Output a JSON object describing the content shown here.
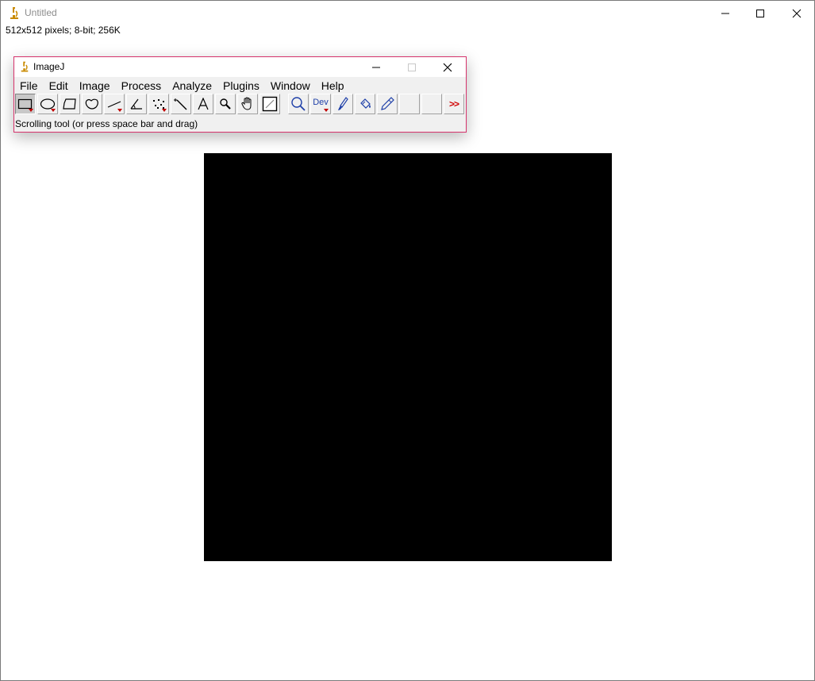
{
  "image_window": {
    "title": "Untitled",
    "info": "512x512 pixels; 8-bit; 256K",
    "icons": {
      "app": "microscope-icon",
      "minimize": "minimize-icon",
      "maximize": "maximize-icon",
      "close": "close-icon"
    }
  },
  "imagej_window": {
    "title": "ImageJ",
    "menu": [
      "File",
      "Edit",
      "Image",
      "Process",
      "Analyze",
      "Plugins",
      "Window",
      "Help"
    ],
    "tools": [
      {
        "name": "rectangle-tool",
        "icon": "rectangle-icon",
        "selected": true,
        "has_menu": true
      },
      {
        "name": "oval-tool",
        "icon": "oval-icon",
        "selected": false,
        "has_menu": true
      },
      {
        "name": "polygon-tool",
        "icon": "polygon-icon",
        "selected": false,
        "has_menu": false
      },
      {
        "name": "freehand-tool",
        "icon": "freehand-icon",
        "selected": false,
        "has_menu": false
      },
      {
        "name": "line-tool",
        "icon": "line-icon",
        "selected": false,
        "has_menu": true
      },
      {
        "name": "angle-tool",
        "icon": "angle-icon",
        "selected": false,
        "has_menu": false
      },
      {
        "name": "point-tool",
        "icon": "multipoint-icon",
        "selected": false,
        "has_menu": true
      },
      {
        "name": "wand-tool",
        "icon": "wand-icon",
        "selected": false,
        "has_menu": false
      },
      {
        "name": "text-tool",
        "icon": "text-icon",
        "selected": false,
        "has_menu": false
      },
      {
        "name": "magnifying-tool",
        "icon": "magnifier-icon",
        "selected": false,
        "has_menu": false
      },
      {
        "name": "scrolling-tool",
        "icon": "hand-icon",
        "selected": false,
        "has_menu": false
      },
      {
        "name": "color-picker-tool",
        "icon": "color-picker-icon",
        "selected": false,
        "has_menu": false
      },
      {
        "name": "zoom-tool",
        "icon": "zoom-icon",
        "selected": false,
        "has_menu": false
      },
      {
        "name": "dev-tool",
        "icon": "dev-icon",
        "label": "Dev",
        "selected": false,
        "has_menu": true
      },
      {
        "name": "brush-tool",
        "icon": "brush-icon",
        "selected": false,
        "has_menu": false
      },
      {
        "name": "flood-fill-tool",
        "icon": "flood-fill-icon",
        "selected": false,
        "has_menu": false
      },
      {
        "name": "pencil-tool",
        "icon": "pencil-icon",
        "selected": false,
        "has_menu": false
      },
      {
        "name": "empty-tool-1",
        "icon": "",
        "selected": false,
        "has_menu": false
      },
      {
        "name": "empty-tool-2",
        "icon": "",
        "selected": false,
        "has_menu": false
      },
      {
        "name": "more-tools",
        "icon": "double-chevron-right-icon",
        "label": ">>",
        "selected": false,
        "has_menu": false
      }
    ],
    "status": "Scrolling tool (or press space bar and drag)"
  },
  "colors": {
    "accent_border": "#d6336c",
    "canvas": "#000000",
    "menu_arrow": "#c00000"
  }
}
